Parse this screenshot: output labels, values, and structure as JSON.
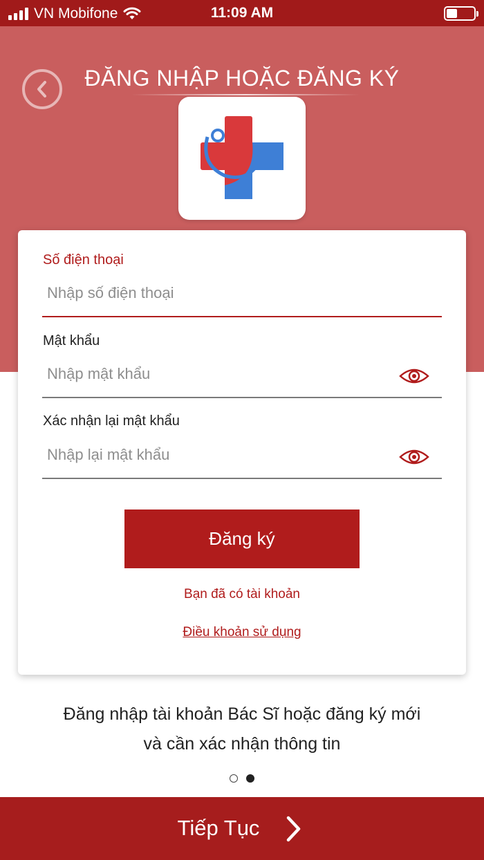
{
  "status_bar": {
    "carrier": "VN Mobifone",
    "time": "11:09 AM",
    "battery_icon": "battery-icon",
    "wifi_icon": "wifi-icon"
  },
  "header": {
    "title": "ĐĂNG NHẬP HOẶC ĐĂNG KÝ",
    "back_icon": "chevron-left-icon",
    "logo_icon": "medical-cross-logo"
  },
  "form": {
    "phone": {
      "label": "Số điện thoại",
      "placeholder": "Nhập số điện thoại",
      "value": ""
    },
    "password": {
      "label": "Mật khẩu",
      "placeholder": "Nhập mật khẩu",
      "value": "",
      "toggle_icon": "eye-icon"
    },
    "confirm_password": {
      "label": "Xác nhận lại mật khẩu",
      "placeholder": "Nhập lại mật khẩu",
      "value": "",
      "toggle_icon": "eye-icon"
    },
    "submit_label": "Đăng ký",
    "have_account_link": "Bạn đã có tài khoản",
    "terms_link": "Điều khoản sử dụng"
  },
  "description": {
    "line1": "Đăng nhập tài khoản Bác Sĩ hoặc đăng ký mới",
    "line2": "và cần xác nhận thông tin"
  },
  "pager": {
    "total": 2,
    "active_index": 1
  },
  "footer": {
    "continue_label": "Tiếp Tục",
    "continue_icon": "chevron-right-icon"
  },
  "colors": {
    "primary": "#b01c1c",
    "status_bar": "#a11a1a",
    "hero": "#c95e5e",
    "footer": "#a61d1d"
  }
}
